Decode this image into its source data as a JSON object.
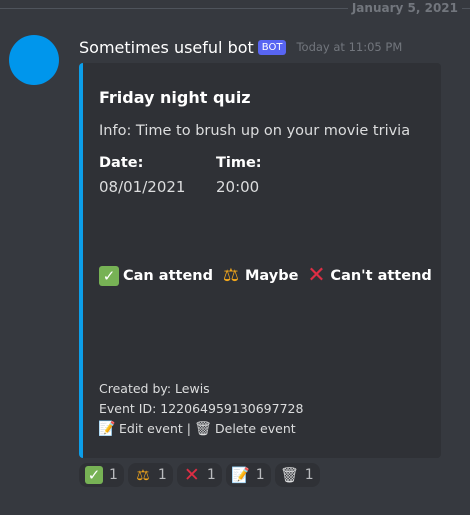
{
  "divider": {
    "date": "January 5, 2021"
  },
  "message": {
    "username": "Sometimes useful bot",
    "bot_tag": "BOT",
    "timestamp": "Today at 11:05 PM"
  },
  "embed": {
    "accent_color": "#0c9ee9",
    "title": "Friday night quiz",
    "info": "Info: Time to brush up on your movie trivia",
    "fields": [
      {
        "name": "Date:",
        "value": "08/01/2021"
      },
      {
        "name": "Time:",
        "value": "20:00"
      }
    ],
    "options": [
      {
        "icon": "white-check-mark",
        "label": "Can attend"
      },
      {
        "icon": "scales",
        "label": "Maybe"
      },
      {
        "icon": "x",
        "label": "Can't attend"
      }
    ],
    "footer": {
      "created_by": "Created by: Lewis",
      "event_id": "Event ID: 122064959130697728",
      "edit_label": "Edit event",
      "separator": "|",
      "delete_label": "Delete event"
    }
  },
  "reactions": [
    {
      "icon": "white-check-mark",
      "count": "1"
    },
    {
      "icon": "scales",
      "count": "1"
    },
    {
      "icon": "x",
      "count": "1"
    },
    {
      "icon": "memo",
      "count": "1"
    },
    {
      "icon": "wastebasket",
      "count": "1"
    }
  ]
}
